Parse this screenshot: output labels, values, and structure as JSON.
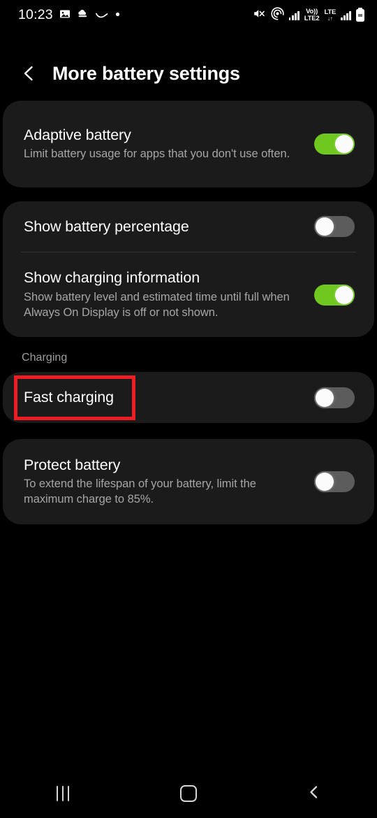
{
  "status_bar": {
    "time": "10:23",
    "left_icons": [
      "image-icon",
      "download-cloud-icon",
      "curve-icon",
      "dot-icon"
    ],
    "right_icons": [
      "mute-icon",
      "hotspot-icon",
      "signal-bars-sim1-icon",
      "volte-lte2-label",
      "lte-label",
      "signal-bars-sim2-icon",
      "battery-icon"
    ],
    "network_sim1_line1": "Vo))",
    "network_sim1_line2": "LTE2",
    "network_sim2_line1": "LTE",
    "network_sim2_line2": "↓↑"
  },
  "header": {
    "back_label": "Back",
    "title": "More battery settings"
  },
  "settings": {
    "adaptive_battery": {
      "title": "Adaptive battery",
      "desc": "Limit battery usage for apps that you don't use often.",
      "state": "on"
    },
    "show_battery_percentage": {
      "title": "Show battery percentage",
      "state": "off"
    },
    "show_charging_information": {
      "title": "Show charging information",
      "desc": "Show battery level and estimated time until full when Always On Display is off or not shown.",
      "state": "on"
    },
    "charging_section_label": "Charging",
    "fast_charging": {
      "title": "Fast charging",
      "state": "off"
    },
    "protect_battery": {
      "title": "Protect battery",
      "desc": "To extend the lifespan of your battery, limit the maximum charge to 85%.",
      "state": "off"
    }
  },
  "annotation": {
    "target": "Fast charging",
    "color": "#ee1c23"
  },
  "nav_bar": {
    "recents_label": "Recents",
    "home_label": "Home",
    "back_label": "Back"
  },
  "colors": {
    "background": "#000000",
    "card": "#1b1b1b",
    "toggle_on": "#6fc71f",
    "toggle_off": "#5c5c5c",
    "title_text": "#ffffff",
    "desc_text": "#a6a6a6",
    "section_text": "#9d9d9d"
  }
}
